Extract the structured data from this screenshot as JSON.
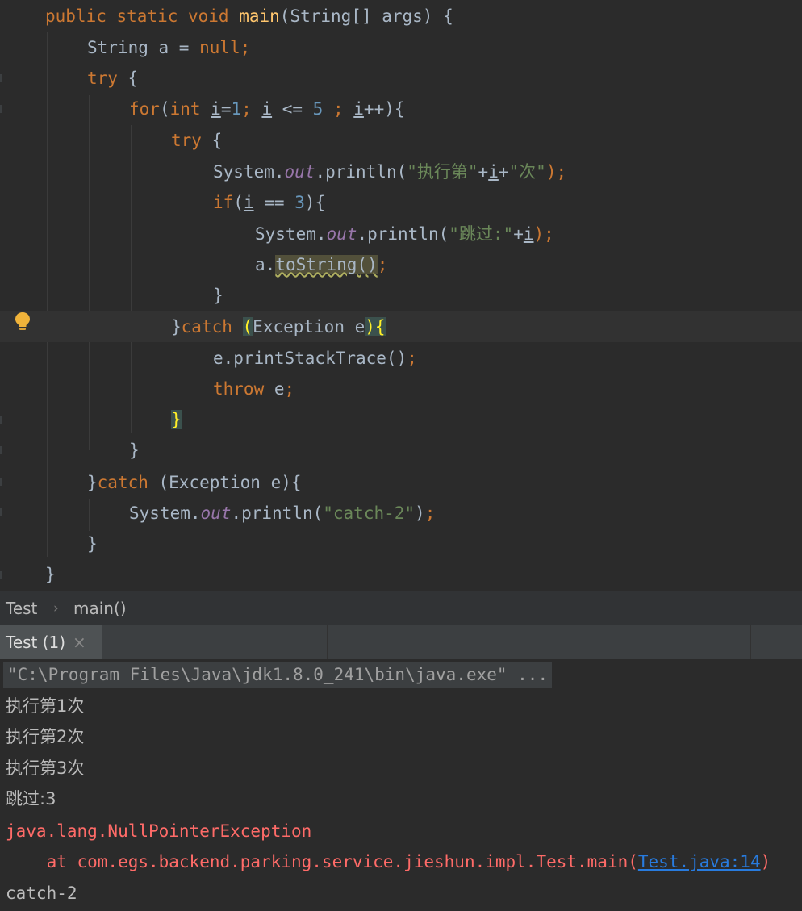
{
  "editor": {
    "lines": {
      "l1": {
        "a": "public static void ",
        "b": "main",
        "c": "(String[] args) {"
      },
      "l2": {
        "a": "String a = ",
        "b": "null",
        ";": ";"
      },
      "l3": {
        "a": "try",
        "b": " {"
      },
      "l4": {
        "a": "for",
        "b": "(",
        "c": "int ",
        "d": "i",
        "e": "=",
        "f": "1",
        "g": "; ",
        "h": "i",
        "i": " <= ",
        "j": "5",
        "k": " ; ",
        "l": "i",
        "m": "++){"
      },
      "l5": {
        "a": "try",
        "b": " {"
      },
      "l6": {
        "a": "System.",
        "b": "out",
        "c": ".println(",
        "d": "\"执行第\"",
        "e": "+",
        "f": "i",
        "g": "+",
        "h": "\"次\"",
        "i": ");"
      },
      "l7": {
        "a": "if",
        "b": "(",
        "c": "i",
        "d": " == ",
        "e": "3",
        "f": "){"
      },
      "l8": {
        "a": "System.",
        "b": "out",
        "c": ".println(",
        "d": "\"跳过:\"",
        "e": "+",
        "f": "i",
        "g": ");"
      },
      "l9": {
        "a": "a.",
        "b": "toString",
        "c": "()",
        ";": ";"
      },
      "l10": {
        "a": "}"
      },
      "l11": {
        "a": "}",
        "b": "catch ",
        "c": "(",
        "d": "Exception e",
        "e": ")",
        "f": "{"
      },
      "l12": {
        "a": "e.printStackTrace()",
        ";": ";"
      },
      "l13": {
        "a": "throw ",
        "b": "e",
        ";": ";"
      },
      "l14": {
        "a": "}"
      },
      "l15": {
        "a": "}"
      },
      "l16": {
        "a": "}",
        "b": "catch ",
        "c": "(Exception e){"
      },
      "l17": {
        "a": "System.",
        "b": "out",
        "c": ".println(",
        "d": "\"catch-2\"",
        "e": ")",
        ";": ";"
      },
      "l18": {
        "a": "}"
      },
      "l19": {
        "a": "}"
      }
    }
  },
  "breadcrumb": {
    "class": "Test",
    "sep": "›",
    "method": "main()"
  },
  "run_tab": {
    "label": "Test (1)",
    "close": "×"
  },
  "console": {
    "command": "\"C:\\Program Files\\Java\\jdk1.8.0_241\\bin\\java.exe\" ...",
    "out1": "执行第1次",
    "out2": "执行第2次",
    "out3": "执行第3次",
    "out4": "跳过:3",
    "exception": "java.lang.NullPointerException",
    "trace_prefix": "    at com.egs.backend.parking.service.jieshun.impl.Test.main(",
    "trace_link": "Test.java:14",
    "trace_suffix": ")",
    "out5": "catch-2"
  }
}
